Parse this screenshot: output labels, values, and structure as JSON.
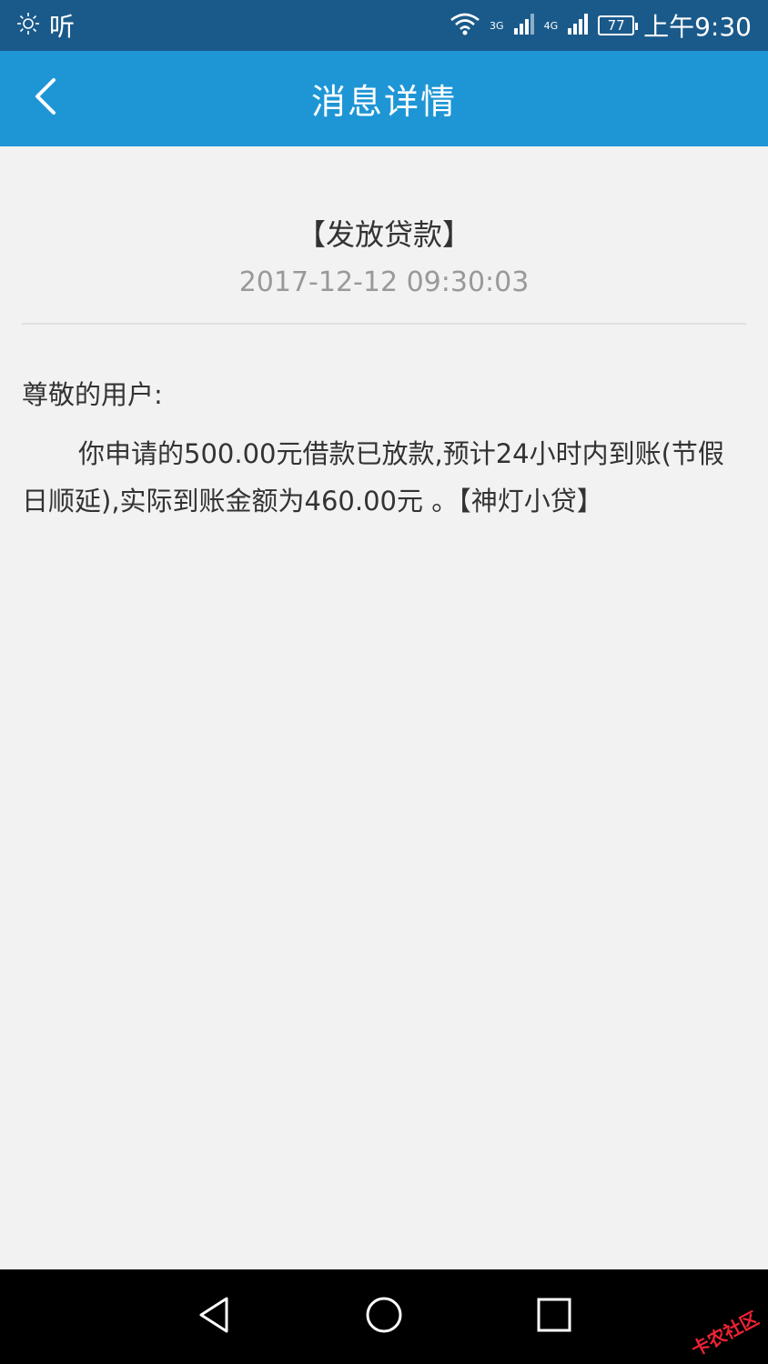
{
  "status_bar": {
    "left_label": "听",
    "signal_3g": "3G",
    "signal_4g": "4G",
    "battery": "77",
    "time": "上午9:30"
  },
  "header": {
    "title": "消息详情"
  },
  "message": {
    "title": "【发放贷款】",
    "time": "2017-12-12 09:30:03",
    "greeting": "尊敬的用户:",
    "body": "你申请的500.00元借款已放款,预计24小时内到账(节假日顺延),实际到账金额为460.00元 。【神灯小贷】"
  },
  "watermark": "卡农社区",
  "colors": {
    "header_bg": "#1e96d5",
    "statusbar_bg": "#1a5a8a",
    "page_bg": "#f2f2f2"
  }
}
